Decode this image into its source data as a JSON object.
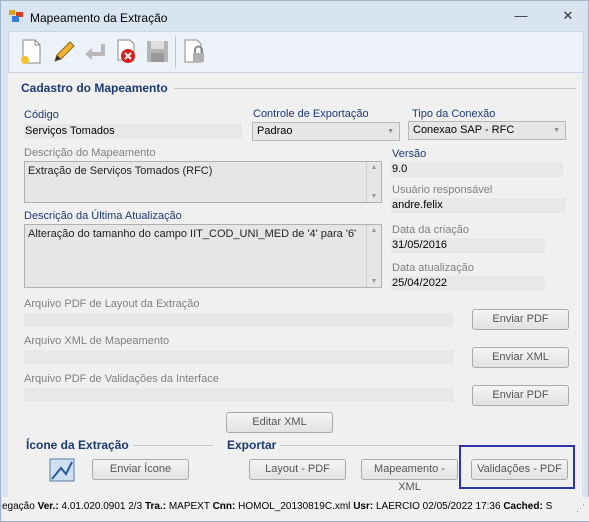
{
  "window": {
    "title": "Mapeamento da Extração",
    "minimize_label": "—",
    "close_label": "✕"
  },
  "toolbar": {
    "icons": [
      "new-icon",
      "edit-icon",
      "undo-icon",
      "delete-icon",
      "save-icon",
      "lock-icon"
    ]
  },
  "cadastro": {
    "section_title": "Cadastro do Mapeamento",
    "codigo_label": "Código",
    "codigo_value": "Serviços Tomados",
    "controle_label": "Controle de Exportação",
    "controle_value": "Padrao",
    "tipo_label": "Tipo da Conexão",
    "tipo_value": "Conexao SAP - RFC",
    "descricao_label": "Descrição do Mapeamento",
    "descricao_value": "Extração de Serviços Tomados (RFC)",
    "versao_label": "Versão",
    "versao_value": "9.0",
    "usuario_label": "Usuário responsável",
    "usuario_value": "andre.felix",
    "ultima_label": "Descrição da Última Atualização",
    "ultima_value": "Alteração do tamanho do campo IIT_COD_UNI_MED de '4' para '6'",
    "criacao_label": "Data da criação",
    "criacao_value": "31/05/2016",
    "atualizacao_label": "Data atualização",
    "atualizacao_value": "25/04/2022",
    "pdf_layout_label": "Arquivo PDF de Layout da Extração",
    "pdf_layout_button": "Enviar PDF",
    "xml_label": "Arquivo XML de Mapeamento",
    "xml_button": "Enviar XML",
    "pdf_valid_label": "Arquivo PDF de Validações da Interface",
    "pdf_valid_button": "Enviar PDF",
    "editar_xml_button": "Editar XML"
  },
  "icone": {
    "section_title": "Ícone da Extração",
    "enviar_button": "Enviar Ícone"
  },
  "exportar": {
    "section_title": "Exportar",
    "layout_button": "Layout - PDF",
    "mapeamento_button": "Mapeamento - XML",
    "validacoes_button": "Validações - PDF"
  },
  "status": {
    "prefix": "egação",
    "ver_label": "Ver.:",
    "ver_value": "4.01.020.0901",
    "page": "2/3",
    "tra_label": "Tra.:",
    "tra_value": "MAPEXT",
    "cnn_label": "Cnn:",
    "cnn_value": "HOMOL_20130819C.xml",
    "usr_label": "Usr:",
    "usr_value": "LAERCIO",
    "date": "02/05/2022",
    "time": "17:36",
    "cached_label": "Cached:",
    "cached_value": "S"
  }
}
